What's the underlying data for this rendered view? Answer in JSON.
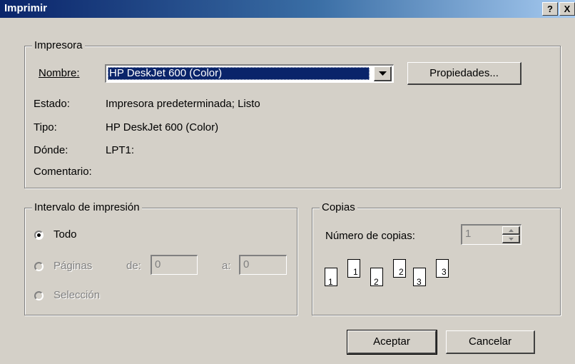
{
  "window": {
    "title": "Imprimir",
    "help_label": "?",
    "close_label": "X"
  },
  "printer": {
    "group_label": "Impresora",
    "name_label": "Nombre:",
    "name_value": "HP DeskJet 600 (Color)",
    "properties_label": "Propiedades...",
    "status_label": "Estado:",
    "status_value": "Impresora predeterminada; Listo",
    "type_label": "Tipo:",
    "type_value": "HP DeskJet 600 (Color)",
    "where_label": "Dónde:",
    "where_value": "LPT1:",
    "comment_label": "Comentario:",
    "comment_value": ""
  },
  "range": {
    "group_label": "Intervalo de impresión",
    "all_label": "Todo",
    "pages_label": "Páginas",
    "from_label": "de:",
    "from_value": "0",
    "to_label": "a:",
    "to_value": "0",
    "selection_label": "Selección",
    "selected": "all"
  },
  "copies": {
    "group_label": "Copias",
    "count_label": "Número de copias:",
    "count_value": "1",
    "collate_pages": [
      "1",
      "1",
      "2",
      "2",
      "3",
      "3"
    ]
  },
  "buttons": {
    "ok_label": "Aceptar",
    "cancel_label": "Cancelar"
  }
}
